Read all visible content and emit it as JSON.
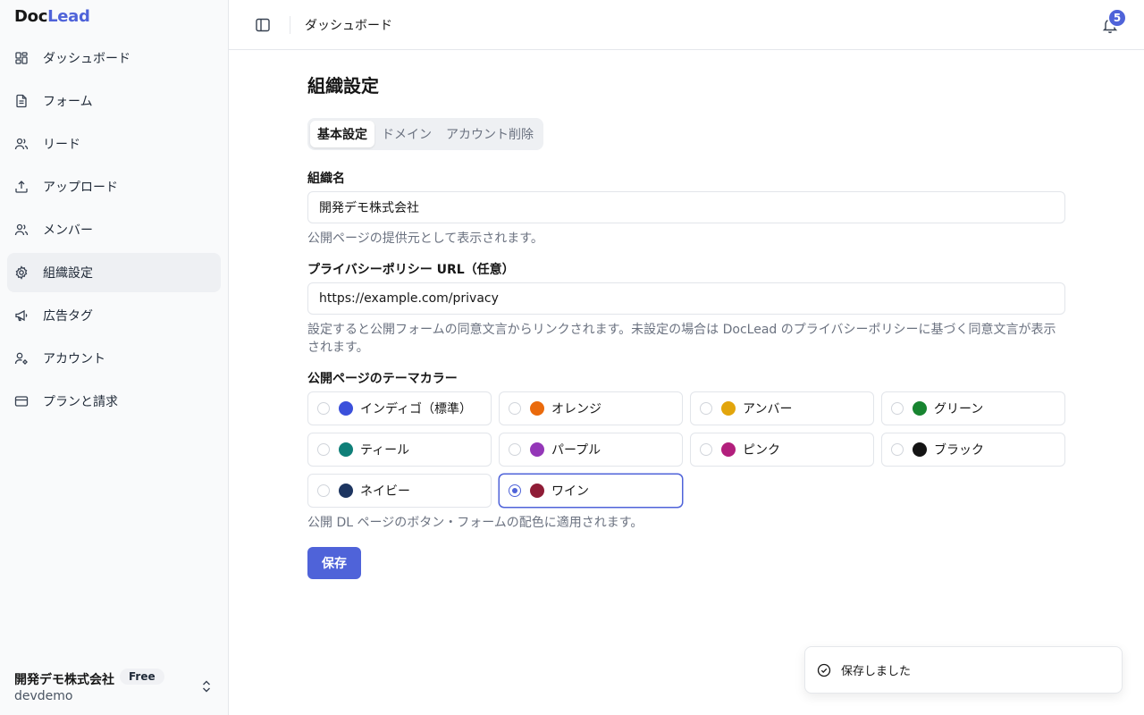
{
  "app": {
    "logo_part1": "Doc",
    "logo_part2": "Lead"
  },
  "sidebar": {
    "items": [
      {
        "label": "ダッシュボード",
        "icon": "dashboard-icon"
      },
      {
        "label": "フォーム",
        "icon": "file-text-icon"
      },
      {
        "label": "リード",
        "icon": "users-icon"
      },
      {
        "label": "アップロード",
        "icon": "upload-icon"
      },
      {
        "label": "メンバー",
        "icon": "users-icon"
      },
      {
        "label": "組織設定",
        "icon": "gear-icon",
        "active": true
      },
      {
        "label": "広告タグ",
        "icon": "megaphone-icon"
      },
      {
        "label": "アカウント",
        "icon": "user-cog-icon"
      },
      {
        "label": "プランと請求",
        "icon": "credit-card-icon"
      }
    ],
    "org": {
      "name": "開発デモ株式会社",
      "plan": "Free",
      "slug": "devdemo"
    }
  },
  "header": {
    "title": "ダッシュボード",
    "notification_count": "5"
  },
  "main": {
    "title": "組織設定",
    "tabs": [
      {
        "label": "基本設定",
        "active": true
      },
      {
        "label": "ドメイン"
      },
      {
        "label": "アカウント削除"
      }
    ],
    "org_name": {
      "label": "組織名",
      "value": "開発デモ株式会社",
      "help": "公開ページの提供元として表示されます。"
    },
    "privacy": {
      "label": "プライバシーポリシー URL（任意）",
      "value": "https://example.com/privacy",
      "help": "設定すると公開フォームの同意文言からリンクされます。未設定の場合は DocLead のプライバシーポリシーに基づく同意文言が表示されます。"
    },
    "theme": {
      "label": "公開ページのテーマカラー",
      "options": [
        {
          "name": "インディゴ（標準）",
          "color": "#3b50db"
        },
        {
          "name": "オレンジ",
          "color": "#ea6a0c"
        },
        {
          "name": "アンバー",
          "color": "#e2a50c"
        },
        {
          "name": "グリーン",
          "color": "#178430"
        },
        {
          "name": "ティール",
          "color": "#0f7f78"
        },
        {
          "name": "パープル",
          "color": "#9437b8"
        },
        {
          "name": "ピンク",
          "color": "#b21f7c"
        },
        {
          "name": "ブラック",
          "color": "#141414"
        },
        {
          "name": "ネイビー",
          "color": "#1d3560"
        },
        {
          "name": "ワイン",
          "color": "#8f1c36",
          "selected": true
        }
      ],
      "help": "公開 DL ページのボタン・フォームの配色に適用されます。"
    },
    "save_label": "保存"
  },
  "toast": {
    "message": "保存しました"
  }
}
